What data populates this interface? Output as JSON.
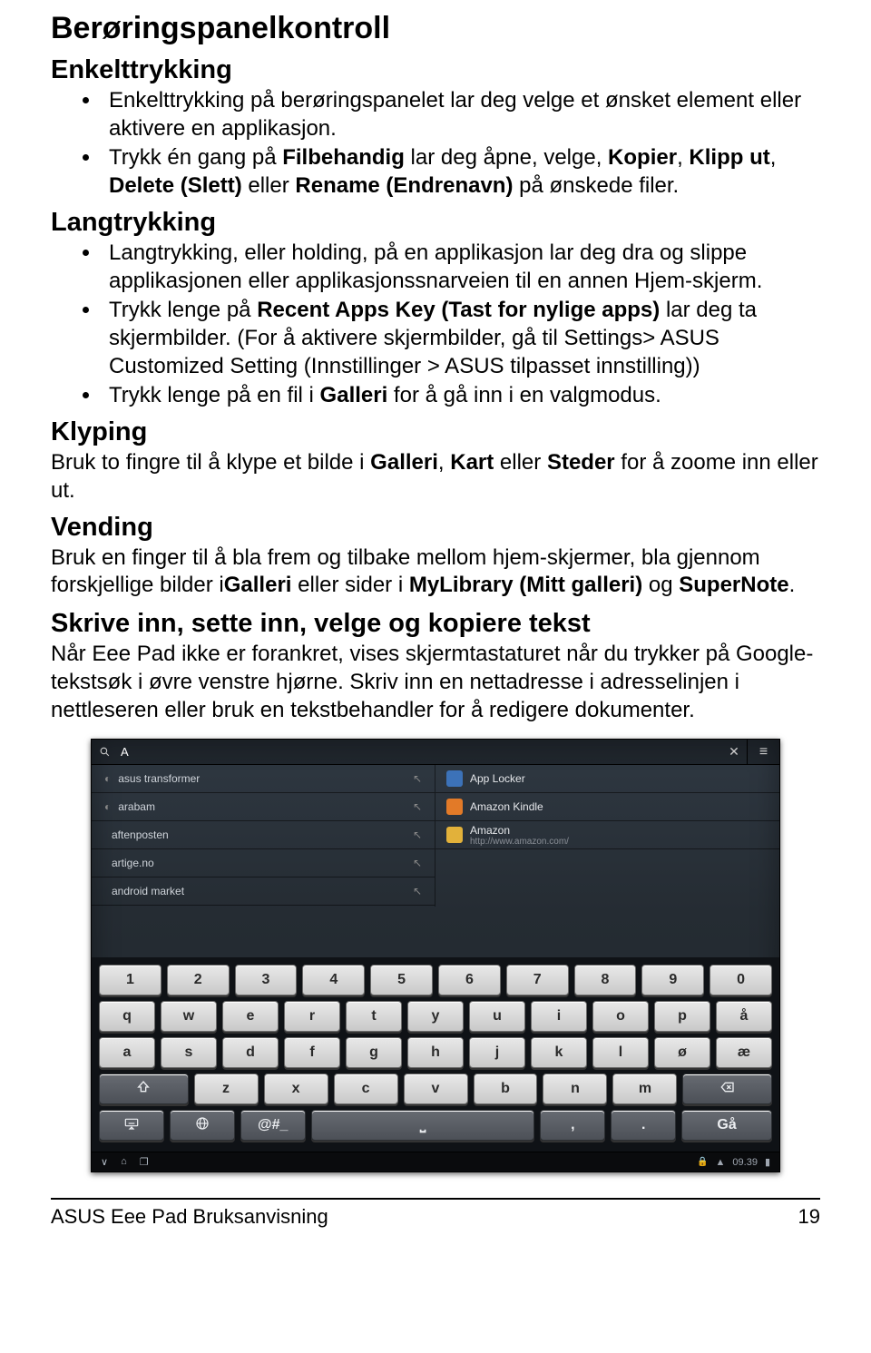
{
  "doc": {
    "title": "Berøringspanelkontroll",
    "s1": {
      "heading": "Enkelttrykking",
      "b1_a": "Enkelttrykking på berøringspanelet lar deg velge et ønsket element eller aktivere en applikasjon.",
      "b2_a": "Trykk én gang på ",
      "b2_b": "Filbehandig",
      "b2_c": " lar deg åpne, velge, ",
      "b2_d": "Kopier",
      "b2_e": ", ",
      "b2_f": "Klipp ut",
      "b2_g": ", ",
      "b2_h": "Delete (Slett)",
      "b2_i": " eller ",
      "b2_j": "Rename (Endrenavn)",
      "b2_k": " på ønskede filer."
    },
    "s2": {
      "heading": "Langtrykking",
      "b1": "Langtrykking, eller holding, på en applikasjon lar deg dra og slippe applikasjonen eller applikasjonssnarveien til en annen Hjem-skjerm.",
      "b2_a": "Trykk lenge på ",
      "b2_b": "Recent Apps Key (Tast for nylige apps)",
      "b2_c": " lar deg ta skjermbilder. (For å aktivere skjermbilder, gå til Settings> ASUS Customized Setting (Innstillinger > ASUS tilpasset innstilling))",
      "b3_a": "Trykk lenge på en fil i ",
      "b3_b": "Galleri",
      "b3_c": " for å gå inn i en valgmodus."
    },
    "s3": {
      "heading": "Klyping",
      "p_a": "Bruk to fingre til å klype et bilde i ",
      "p_b": "Galleri",
      "p_c": ", ",
      "p_d": "Kart",
      "p_e": " eller ",
      "p_f": "Steder",
      "p_g": " for å zoome inn eller ut."
    },
    "s4": {
      "heading": "Vending",
      "p_a": "Bruk en finger til å bla frem og tilbake mellom hjem-skjermer, bla gjennom forskjellige bilder i",
      "p_b": "Galleri",
      "p_c": " eller sider i ",
      "p_d": "MyLibrary (Mitt galleri)",
      "p_e": " og ",
      "p_f": "SuperNote",
      "p_g": "."
    },
    "s5": {
      "heading": "Skrive inn, sette inn, velge og kopiere tekst",
      "p": "Når Eee Pad ikke er forankret, vises skjermtastaturet når du trykker på Google-tekstsøk i øvre venstre hjørne. Skriv inn en nettadresse i adresselinjen i nettleseren eller bruk en tekstbehandler for å redigere dokumenter."
    },
    "footer_left": "ASUS Eee Pad Bruksanvisning",
    "footer_right": "19"
  },
  "tablet": {
    "search_value": "A",
    "suggestions": [
      {
        "icon": "◐",
        "label": "asus transformer"
      },
      {
        "icon": "◐",
        "label": "arabam"
      },
      {
        "icon": "",
        "label": "aftenposten"
      },
      {
        "icon": "",
        "label": "artige.no"
      },
      {
        "icon": "",
        "label": "android market"
      }
    ],
    "apps": [
      {
        "name": "App Locker",
        "sub": "",
        "color": "#3c72b8"
      },
      {
        "name": "Amazon Kindle",
        "sub": "",
        "color": "#e27a28"
      },
      {
        "name": "Amazon",
        "sub": "http://www.amazon.com/",
        "color": "#e2b13a"
      }
    ],
    "keyboard": {
      "row1": [
        "1",
        "2",
        "3",
        "4",
        "5",
        "6",
        "7",
        "8",
        "9",
        "0"
      ],
      "row2": [
        "q",
        "w",
        "e",
        "r",
        "t",
        "y",
        "u",
        "i",
        "o",
        "p",
        "å"
      ],
      "row3": [
        "a",
        "s",
        "d",
        "f",
        "g",
        "h",
        "j",
        "k",
        "l",
        "ø",
        "æ"
      ],
      "row4_letters": [
        "z",
        "x",
        "c",
        "v",
        "b",
        "n",
        "m"
      ],
      "sym": "@#_",
      "comma": ",",
      "period": ".",
      "go": "Gå"
    },
    "status_time": "09.39"
  }
}
